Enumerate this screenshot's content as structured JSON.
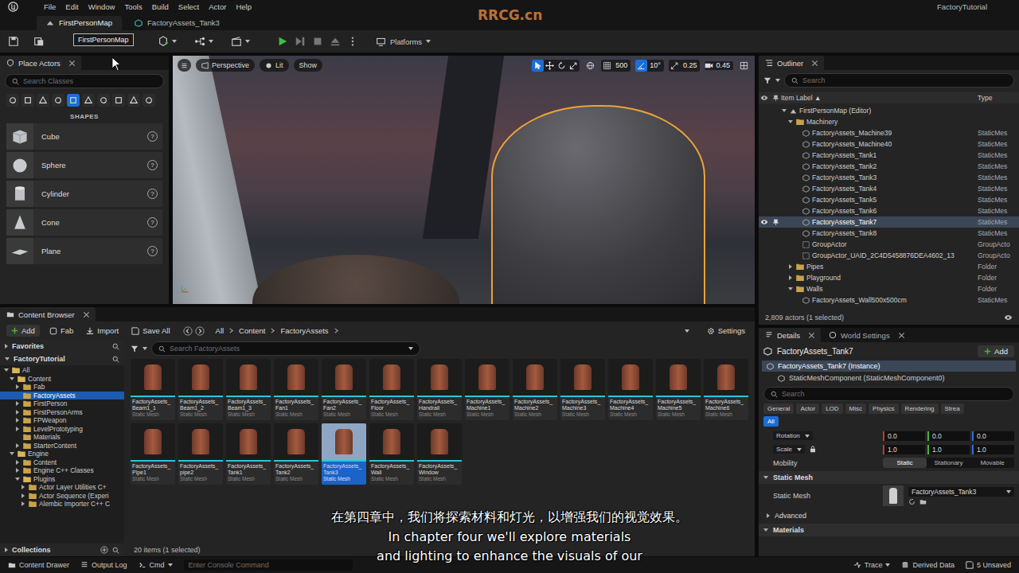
{
  "menu_bar": {
    "items": [
      "File",
      "Edit",
      "Window",
      "Tools",
      "Build",
      "Select",
      "Actor",
      "Help"
    ],
    "project": "FactoryTutorial",
    "watermark": "RRCG.cn"
  },
  "document_tabs": [
    {
      "label": "FirstPersonMap",
      "selected": true
    },
    {
      "label": "FactoryAssets_Tank3",
      "selected": false
    }
  ],
  "toolbar": {
    "tooltip": "FirstPersonMap",
    "platforms": "Platforms",
    "play_buttons": [
      {
        "enabled": true
      },
      {
        "enabled": false
      },
      {
        "enabled": false
      },
      {
        "enabled": false
      }
    ]
  },
  "place_actors": {
    "title": "Place Actors",
    "search_placeholder": "Search Classes",
    "categories": [
      {
        "selected": false
      },
      {
        "selected": false
      },
      {
        "selected": false
      },
      {
        "selected": false
      },
      {
        "selected": true
      },
      {
        "selected": false
      },
      {
        "selected": false
      },
      {
        "selected": false
      },
      {
        "selected": false
      },
      {
        "selected": false
      }
    ],
    "section": "SHAPES",
    "shapes": [
      "Cube",
      "Sphere",
      "Cylinder",
      "Cone",
      "Plane"
    ],
    "help": "?"
  },
  "viewport": {
    "view": "Perspective",
    "mode": "Lit",
    "show": "Show",
    "transform_tools": [
      {
        "selected": true
      },
      {
        "selected": false
      },
      {
        "selected": false
      },
      {
        "selected": false
      }
    ],
    "snaps": [
      {
        "value": "500",
        "on": false
      },
      {
        "value": "10°",
        "on": true
      },
      {
        "value": "0.25",
        "on": false
      }
    ],
    "camera_speed": "0.45"
  },
  "outliner": {
    "title": "Outliner",
    "search_placeholder": "Search",
    "columns": [
      "Item Label ▲",
      "Type"
    ],
    "rows": [
      {
        "label": "FirstPersonMap (Editor)",
        "type": "",
        "kind": "map",
        "depth": 0,
        "expanded": true,
        "selected": false
      },
      {
        "label": "Machinery",
        "type": "",
        "kind": "folder",
        "depth": 1,
        "expanded": true,
        "selected": false
      },
      {
        "label": "FactoryAssets_Machine39",
        "type": "StaticMes",
        "kind": "actor",
        "depth": 2,
        "expanded": false,
        "selected": false
      },
      {
        "label": "FactoryAssets_Machine40",
        "type": "StaticMes",
        "kind": "actor",
        "depth": 2,
        "expanded": false,
        "selected": false
      },
      {
        "label": "FactoryAssets_Tank1",
        "type": "StaticMes",
        "kind": "actor",
        "depth": 2,
        "expanded": false,
        "selected": false
      },
      {
        "label": "FactoryAssets_Tank2",
        "type": "StaticMes",
        "kind": "actor",
        "depth": 2,
        "expanded": false,
        "selected": false
      },
      {
        "label": "FactoryAssets_Tank3",
        "type": "StaticMes",
        "kind": "actor",
        "depth": 2,
        "expanded": false,
        "selected": false
      },
      {
        "label": "FactoryAssets_Tank4",
        "type": "StaticMes",
        "kind": "actor",
        "depth": 2,
        "expanded": false,
        "selected": false
      },
      {
        "label": "FactoryAssets_Tank5",
        "type": "StaticMes",
        "kind": "actor",
        "depth": 2,
        "expanded": false,
        "selected": false
      },
      {
        "label": "FactoryAssets_Tank6",
        "type": "StaticMes",
        "kind": "actor",
        "depth": 2,
        "expanded": false,
        "selected": false
      },
      {
        "label": "FactoryAssets_Tank7",
        "type": "StaticMes",
        "kind": "actor",
        "depth": 2,
        "expanded": false,
        "selected": true
      },
      {
        "label": "FactoryAssets_Tank8",
        "type": "StaticMes",
        "kind": "actor",
        "depth": 2,
        "expanded": false,
        "selected": false
      },
      {
        "label": "GroupActor",
        "type": "GroupActo",
        "kind": "group",
        "depth": 2,
        "expanded": false,
        "selected": false
      },
      {
        "label": "GroupActor_UAID_2C4D5458876DEA4602_13",
        "type": "GroupActo",
        "kind": "group",
        "depth": 2,
        "expanded": false,
        "selected": false
      },
      {
        "label": "Pipes",
        "type": "Folder",
        "kind": "folder",
        "depth": 1,
        "expanded": false,
        "selected": false
      },
      {
        "label": "Playground",
        "type": "Folder",
        "kind": "folder",
        "depth": 1,
        "expanded": false,
        "selected": false
      },
      {
        "label": "Walls",
        "type": "Folder",
        "kind": "folder",
        "depth": 1,
        "expanded": true,
        "selected": false
      },
      {
        "label": "FactoryAssets_Wall500x500cm",
        "type": "StaticMes",
        "kind": "actor",
        "depth": 2,
        "expanded": false,
        "selected": false
      }
    ],
    "footer": "2,809 actors (1 selected)"
  },
  "content_browser": {
    "title": "Content Browser",
    "add": "Add",
    "fab": "Fab",
    "import": "Import",
    "save_all": "Save All",
    "settings": "Settings",
    "path": [
      "All",
      "Content",
      "FactoryAssets"
    ],
    "favorites": "Favorites",
    "project": "FactoryTutorial",
    "tree": [
      {
        "label": "All",
        "depth": 0,
        "branch": true,
        "expanded": true,
        "selected": false
      },
      {
        "label": "Content",
        "depth": 1,
        "branch": true,
        "expanded": true,
        "selected": false
      },
      {
        "label": "Fab",
        "depth": 2,
        "branch": true,
        "expanded": false,
        "selected": false
      },
      {
        "label": "FactoryAssets",
        "depth": 2,
        "branch": false,
        "expanded": false,
        "selected": true
      },
      {
        "label": "FirstPerson",
        "depth": 2,
        "branch": true,
        "expanded": false,
        "selected": false
      },
      {
        "label": "FirstPersonArms",
        "depth": 2,
        "branch": true,
        "expanded": false,
        "selected": false
      },
      {
        "label": "FPWeapon",
        "depth": 2,
        "branch": true,
        "expanded": false,
        "selected": false
      },
      {
        "label": "LevelPrototyping",
        "depth": 2,
        "branch": true,
        "expanded": false,
        "selected": false
      },
      {
        "label": "Materials",
        "depth": 2,
        "branch": false,
        "expanded": false,
        "selected": false
      },
      {
        "label": "StarterContent",
        "depth": 2,
        "branch": true,
        "expanded": false,
        "selected": false
      },
      {
        "label": "Engine",
        "depth": 1,
        "branch": true,
        "expanded": true,
        "selected": false
      },
      {
        "label": "Content",
        "depth": 2,
        "branch": true,
        "expanded": false,
        "selected": false
      },
      {
        "label": "Engine C++ Classes",
        "depth": 2,
        "branch": true,
        "expanded": false,
        "selected": false
      },
      {
        "label": "Plugins",
        "depth": 2,
        "branch": true,
        "expanded": true,
        "selected": false
      },
      {
        "label": "Actor Layer Utilities C+",
        "depth": 3,
        "branch": true,
        "expanded": false,
        "selected": false
      },
      {
        "label": "Actor Sequence (Experi",
        "depth": 3,
        "branch": true,
        "expanded": false,
        "selected": false
      },
      {
        "label": "Alembic Importer C++ C",
        "depth": 3,
        "branch": true,
        "expanded": false,
        "selected": false
      }
    ],
    "collections": "Collections",
    "search_placeholder": "Search FactoryAssets",
    "assets": [
      {
        "name": "FactoryAssets_Beam1_1",
        "type": "Static Mesh",
        "selected": false
      },
      {
        "name": "FactoryAssets_Beam1_2",
        "type": "Static Mesh",
        "selected": false
      },
      {
        "name": "FactoryAssets_Beam1_3",
        "type": "Static Mesh",
        "selected": false
      },
      {
        "name": "FactoryAssets_Fan1",
        "type": "Static Mesh",
        "selected": false
      },
      {
        "name": "FactoryAssets_Fan2",
        "type": "Static Mesh",
        "selected": false
      },
      {
        "name": "FactoryAssets_Floor",
        "type": "Static Mesh",
        "selected": false
      },
      {
        "name": "FactoryAssets_Handrail",
        "type": "Static Mesh",
        "selected": false
      },
      {
        "name": "FactoryAssets_Machine1",
        "type": "Static Mesh",
        "selected": false
      },
      {
        "name": "FactoryAssets_Machine2",
        "type": "Static Mesh",
        "selected": false
      },
      {
        "name": "FactoryAssets_Machine3",
        "type": "Static Mesh",
        "selected": false
      },
      {
        "name": "FactoryAssets_Machine4",
        "type": "Static Mesh",
        "selected": false
      },
      {
        "name": "FactoryAssets_Machine5",
        "type": "Static Mesh",
        "selected": false
      },
      {
        "name": "FactoryAssets_Machine6",
        "type": "Static Mesh",
        "selected": false
      },
      {
        "name": "FactoryAssets_Pipe1",
        "type": "Static Mesh",
        "selected": false
      },
      {
        "name": "FactoryAssets_pipe2",
        "type": "Static Mesh",
        "selected": false
      },
      {
        "name": "FactoryAssets_Tank1",
        "type": "Static Mesh",
        "selected": false
      },
      {
        "name": "FactoryAssets_Tank2",
        "type": "Static Mesh",
        "selected": false
      },
      {
        "name": "FactoryAssets_Tank3",
        "type": "Static Mesh",
        "selected": true
      },
      {
        "name": "FactoryAssets_Wall",
        "type": "Static Mesh",
        "selected": false
      },
      {
        "name": "FactoryAssets_Window",
        "type": "Static Mesh",
        "selected": false
      }
    ],
    "footer": "20 items (1 selected)"
  },
  "details": {
    "tabs": [
      {
        "label": "Details",
        "selected": true
      },
      {
        "label": "World Settings",
        "selected": false
      }
    ],
    "actor": "FactoryAssets_Tank7",
    "add": "Add",
    "components": [
      {
        "label": "FactoryAssets_Tank7 (Instance)",
        "depth": 0,
        "selected": true
      },
      {
        "label": "StaticMeshComponent (StaticMeshComponent0)",
        "depth": 1,
        "selected": false
      }
    ],
    "search_placeholder": "Search",
    "filters": [
      {
        "label": "General",
        "selected": false
      },
      {
        "label": "Actor",
        "selected": false
      },
      {
        "label": "LOD",
        "selected": false
      },
      {
        "label": "Misc",
        "selected": false
      },
      {
        "label": "Physics",
        "selected": false
      },
      {
        "label": "Rendering",
        "selected": false
      },
      {
        "label": "Strea",
        "selected": false
      }
    ],
    "all_filter": {
      "label": "All",
      "selected": true
    },
    "vectors": [
      {
        "label": "Rotation",
        "locked": false,
        "values": [
          {
            "value": "0.0",
            "color": "#c0392b"
          },
          {
            "value": "0.0",
            "color": "#4caf3a"
          },
          {
            "value": "0.0",
            "color": "#2f6fd6"
          }
        ]
      },
      {
        "label": "Scale",
        "locked": true,
        "values": [
          {
            "value": "1.0",
            "color": "#c0392b"
          },
          {
            "value": "1.0",
            "color": "#4caf3a"
          },
          {
            "value": "1.0",
            "color": "#2f6fd6"
          }
        ]
      }
    ],
    "mobility": {
      "label": "Mobility",
      "options": [
        {
          "label": "Static",
          "selected": true
        },
        {
          "label": "Stationary",
          "selected": false
        },
        {
          "label": "Movable",
          "selected": false
        }
      ]
    },
    "static_mesh_section": "Static Mesh",
    "static_mesh_label": "Static Mesh",
    "static_mesh_value": "FactoryAssets_Tank3",
    "advanced": "Advanced",
    "materials": "Materials"
  },
  "status_bar": {
    "content_drawer": "Content Drawer",
    "output_log": "Output Log",
    "cmd": "Cmd",
    "console_placeholder": "Enter Console Command",
    "trace": "Trace",
    "derived_data": "Derived Data",
    "unsaved": "5 Unsaved"
  },
  "subtitles": {
    "zh": "在第四章中，我们将探索材料和灯光，以增强我们的视觉效果。",
    "en": [
      "In chapter four we'll explore materials",
      "and lighting to enhance the visuals of our"
    ]
  }
}
